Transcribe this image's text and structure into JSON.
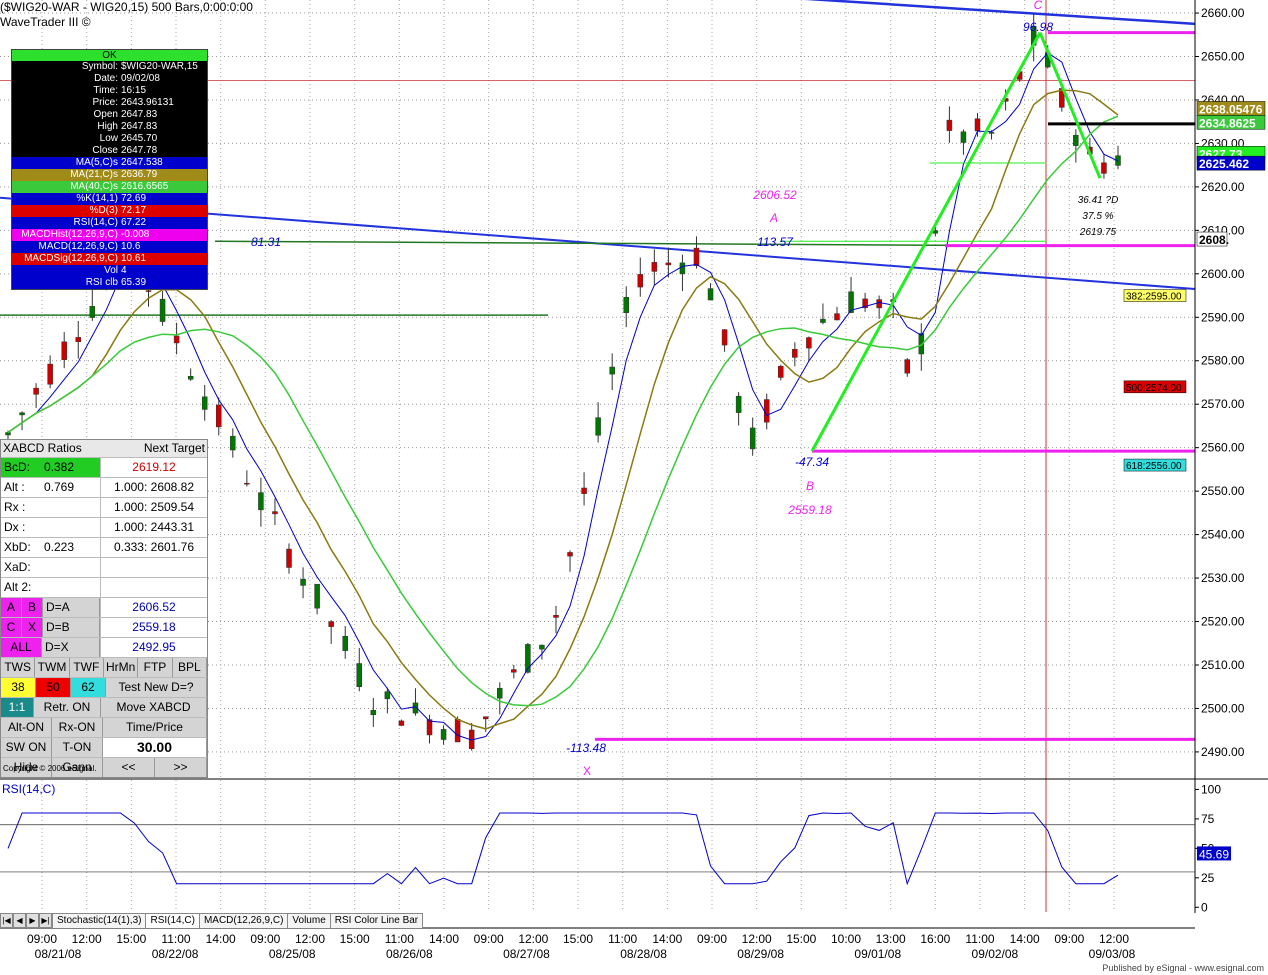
{
  "header": {
    "title": "($WIG20-WAR - WIG20,15) 500 Bars,0:00:0:00",
    "subtitle": "WaveTrader III ©"
  },
  "data_window": {
    "status": "OK",
    "rows": [
      {
        "label": "Symbol:",
        "value": "$WIG20-WAR,15",
        "bg": "#000000",
        "fg": "#ffffff"
      },
      {
        "label": "Date:",
        "value": "09/02/08",
        "bg": "#000000",
        "fg": "#ffffff"
      },
      {
        "label": "Time:",
        "value": "16:15",
        "bg": "#000000",
        "fg": "#ffffff"
      },
      {
        "label": "Price:",
        "value": "2643.96131",
        "bg": "#000000",
        "fg": "#ffffff"
      },
      {
        "label": "Open",
        "value": "2647.83",
        "bg": "#000000",
        "fg": "#ffffff"
      },
      {
        "label": "High",
        "value": "2647.83",
        "bg": "#000000",
        "fg": "#ffffff"
      },
      {
        "label": "Low",
        "value": "2645.70",
        "bg": "#000000",
        "fg": "#ffffff"
      },
      {
        "label": "Close",
        "value": "2647.78",
        "bg": "#000000",
        "fg": "#ffffff"
      },
      {
        "label": "MA(5,C)s",
        "value": "2647.538",
        "bg": "#0000cc",
        "fg": "#ffffff"
      },
      {
        "label": "MA(21,C)s",
        "value": "2636.79",
        "bg": "#a08a18",
        "fg": "#ffffff"
      },
      {
        "label": "MA(40,C)s",
        "value": "2616.6565",
        "bg": "#3ac93a",
        "fg": "#ffffff"
      },
      {
        "label": "%K(14,1)",
        "value": "72.69",
        "bg": "#0000cc",
        "fg": "#ffffff"
      },
      {
        "label": "%D(3)",
        "value": "72.17",
        "bg": "#dd0000",
        "fg": "#ffffff"
      },
      {
        "label": "RSI(14,C)",
        "value": "67.22",
        "bg": "#0000cc",
        "fg": "#ffffff"
      },
      {
        "label": "MACDHist(12,26,9,C)",
        "value": "-0.008",
        "bg": "#ee00ee",
        "fg": "#ffffff"
      },
      {
        "label": "MACD(12,26,9,C)",
        "value": "10.6",
        "bg": "#0000cc",
        "fg": "#ffffff"
      },
      {
        "label": "MACDSig(12,26,9,C)",
        "value": "10.61",
        "bg": "#dd0000",
        "fg": "#ffffff"
      },
      {
        "label": "Vol",
        "value": "4",
        "bg": "#0000cc",
        "fg": "#ffffff"
      },
      {
        "label": "RSI clb",
        "value": "65.39",
        "bg": "#0000cc",
        "fg": "#ffffff"
      }
    ]
  },
  "xabcd_panel": {
    "head_left": "XABCD Ratios",
    "head_right": "Next Target",
    "ratios": [
      {
        "name": "BcD:",
        "ratio": "0.382",
        "target": "2619.12",
        "target_color": "#cc0000"
      },
      {
        "name": "Alt  :",
        "ratio": "0.769",
        "target": "1.000: 2608.82",
        "target_color": "#000000"
      },
      {
        "name": "Rx  :",
        "ratio": "",
        "target": "1.000: 2509.54",
        "target_color": "#000000"
      },
      {
        "name": "Dx  :",
        "ratio": "",
        "target": "1.000: 2443.31",
        "target_color": "#000000"
      },
      {
        "name": "XbD:",
        "ratio": "0.223",
        "target": "0.333: 2601.76",
        "target_color": "#000000"
      },
      {
        "name": "XaD:",
        "ratio": "",
        "target": "",
        "target_color": "#000000"
      },
      {
        "name": "Alt 2:",
        "ratio": "",
        "target": "",
        "target_color": "#000000"
      }
    ],
    "equals": [
      {
        "a": "A",
        "b": "B",
        "eq": "D=A",
        "val": "2606.52"
      },
      {
        "a": "C",
        "b": "X",
        "eq": "D=B",
        "val": "2559.18"
      },
      {
        "a": "ALL",
        "b": "",
        "eq": "D=X",
        "val": "2492.95"
      }
    ],
    "tool_buttons": [
      "TWS",
      "TWM",
      "TWF",
      "HrMn",
      "FTP",
      "BPL"
    ],
    "fib_values": [
      "38",
      "50",
      "62"
    ],
    "test_new": "Test New D=?",
    "retr_ratio": "1:1",
    "retr_on": "Retr. ON",
    "move": "Move XABCD",
    "alt_on": "Alt-ON",
    "rx_on": "Rx-ON",
    "time_price": "Time/Price",
    "sw_on": "SW ON",
    "t_on": "T-ON",
    "time_value": "30.00",
    "hide": "Hide",
    "gann": "Gann",
    "prev": "<<",
    "next": ">>",
    "copyright": "Copyright © 2006 eSignal."
  },
  "chart_data": {
    "type": "candlestick",
    "price_axis": {
      "ylim": [
        2484,
        2663
      ],
      "ticks": [
        2490,
        2500,
        2510,
        2520,
        2530,
        2540,
        2550,
        2560,
        2570,
        2580,
        2590,
        2600,
        2610,
        2620,
        2630,
        2640,
        2650,
        2660
      ]
    },
    "time_axis": {
      "time_labels": [
        "09:00",
        "12:00",
        "15:00",
        "11:00",
        "14:00",
        "09:00",
        "12:00",
        "15:00",
        "11:00",
        "14:00",
        "09:00",
        "12:00",
        "15:00",
        "11:00",
        "14:00",
        "09:00",
        "12:00",
        "15:00",
        "10:00",
        "13:00",
        "16:00",
        "11:00",
        "14:00",
        "09:00",
        "12:00"
      ],
      "date_labels": [
        "08/21/08",
        "08/22/08",
        "08/25/08",
        "08/26/08",
        "08/27/08",
        "08/28/08",
        "08/29/08",
        "09/01/08",
        "09/02/08",
        "09/03/08"
      ]
    },
    "swing_points": [
      {
        "day": 8.6,
        "price": 2563
      },
      {
        "day": 16.0,
        "price": 2606
      },
      {
        "day": 24.0,
        "price": 2548
      },
      {
        "day": 31.0,
        "price": 2502
      },
      {
        "day": 37.0,
        "price": 2494
      },
      {
        "day": 42.0,
        "price": 2520
      },
      {
        "day": 47.0,
        "price": 2600
      },
      {
        "day": 51.0,
        "price": 2605
      },
      {
        "day": 54.0,
        "price": 2560
      },
      {
        "day": 57.0,
        "price": 2585
      },
      {
        "day": 60.5,
        "price": 2595
      },
      {
        "day": 63.0,
        "price": 2590
      },
      {
        "day": 64.0,
        "price": 2570
      },
      {
        "day": 66.0,
        "price": 2632
      },
      {
        "day": 69.0,
        "price": 2632
      },
      {
        "day": 71.5,
        "price": 2655
      },
      {
        "day": 73.0,
        "price": 2640
      },
      {
        "day": 75.0,
        "price": 2625
      },
      {
        "day": 76.5,
        "price": 2627
      }
    ],
    "pattern_points": [
      {
        "label": "X",
        "price": 2492.95,
        "osc": "-113.48"
      },
      {
        "label": "A",
        "price": 2606.52,
        "osc": "113.57"
      },
      {
        "label": "B",
        "price": 2559.18,
        "osc": "-47.34"
      },
      {
        "label": "C",
        "price": 2655.5,
        "osc": "96.98"
      }
    ],
    "d_annotation": [
      "36.41 ?D",
      "37.5 %",
      "2619.75"
    ],
    "other_swing_label": "81.31",
    "level_boxes": [
      {
        "text": "382:2595.00",
        "price": 2595.0,
        "bg": "#ffff66",
        "fg": "#000000"
      },
      {
        "text": "500:2574.00",
        "price": 2574.0,
        "bg": "#dd0000",
        "fg": "#000000"
      },
      {
        "text": "618:2556.00",
        "price": 2556.0,
        "bg": "#33dddd",
        "fg": "#000000"
      }
    ],
    "price_tags": [
      {
        "text": "2638.05476",
        "price": 2638.05,
        "bg": "#a08a18",
        "fg": "#ffffff"
      },
      {
        "text": "2634.8625",
        "price": 2634.86,
        "bg": "#3ac93a",
        "fg": "#ffffff"
      },
      {
        "text": "2627.73",
        "price": 2627.73,
        "bg": "#22ee22",
        "fg": "#ffffff"
      },
      {
        "text": "2625.462",
        "price": 2625.46,
        "bg": "#0000cc",
        "fg": "#ffffff"
      },
      {
        "text": "2608.",
        "price": 2608.0,
        "bg": "#ffffff",
        "fg": "#000000"
      }
    ],
    "rsi_pane": {
      "title": "RSI(14,C)",
      "ylim": [
        -4,
        108
      ],
      "ticks": [
        0,
        25,
        50,
        75,
        100
      ],
      "levels": [
        30,
        70
      ],
      "current_value": "45.69",
      "current_value_num": 45.69
    },
    "tabs": [
      "Stochastic(14(1),3)",
      "RSI(14,C)",
      "MACD(12,26,9,C)",
      "Volume",
      "RSI Color Line Bar"
    ],
    "active_tab": 1,
    "footer": "Published by eSignal - www.esignal.com"
  }
}
